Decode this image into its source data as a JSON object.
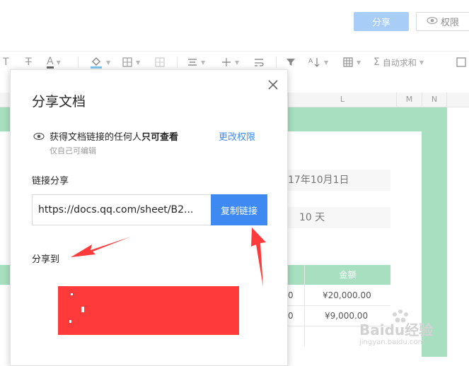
{
  "header": {
    "share_button": "分享",
    "permission_button": "权限"
  },
  "toolbar": {
    "autosum_label": "自动求和"
  },
  "sheet": {
    "columns": [
      "L",
      "M",
      "N"
    ],
    "date_cell": "17年10月1日",
    "days_cell": "10 天",
    "table_header_amount": "金额",
    "rows": [
      {
        "left": "0",
        "amount": "¥20,000.00"
      },
      {
        "left": "0",
        "amount": "¥9,000.00"
      }
    ]
  },
  "dialog": {
    "title": "分享文档",
    "permission_text": "获得文档链接的任何人",
    "permission_strong": "只可查看",
    "change_permission": "更改权限",
    "permission_sub": "仅自己可编辑",
    "link_label": "链接分享",
    "link_value": "https://docs.qq.com/sheet/B2...",
    "copy_button": "复制链接",
    "share_to_label": "分享到"
  },
  "watermark": {
    "brand": "Baidu经验",
    "site": "jingyan.baidu.com"
  },
  "colors": {
    "accent_blue": "#3e8af2",
    "share_button_bg": "#a8cdf6",
    "sheet_green": "#a7dfc0",
    "annotation_red": "#ff3a3a"
  }
}
